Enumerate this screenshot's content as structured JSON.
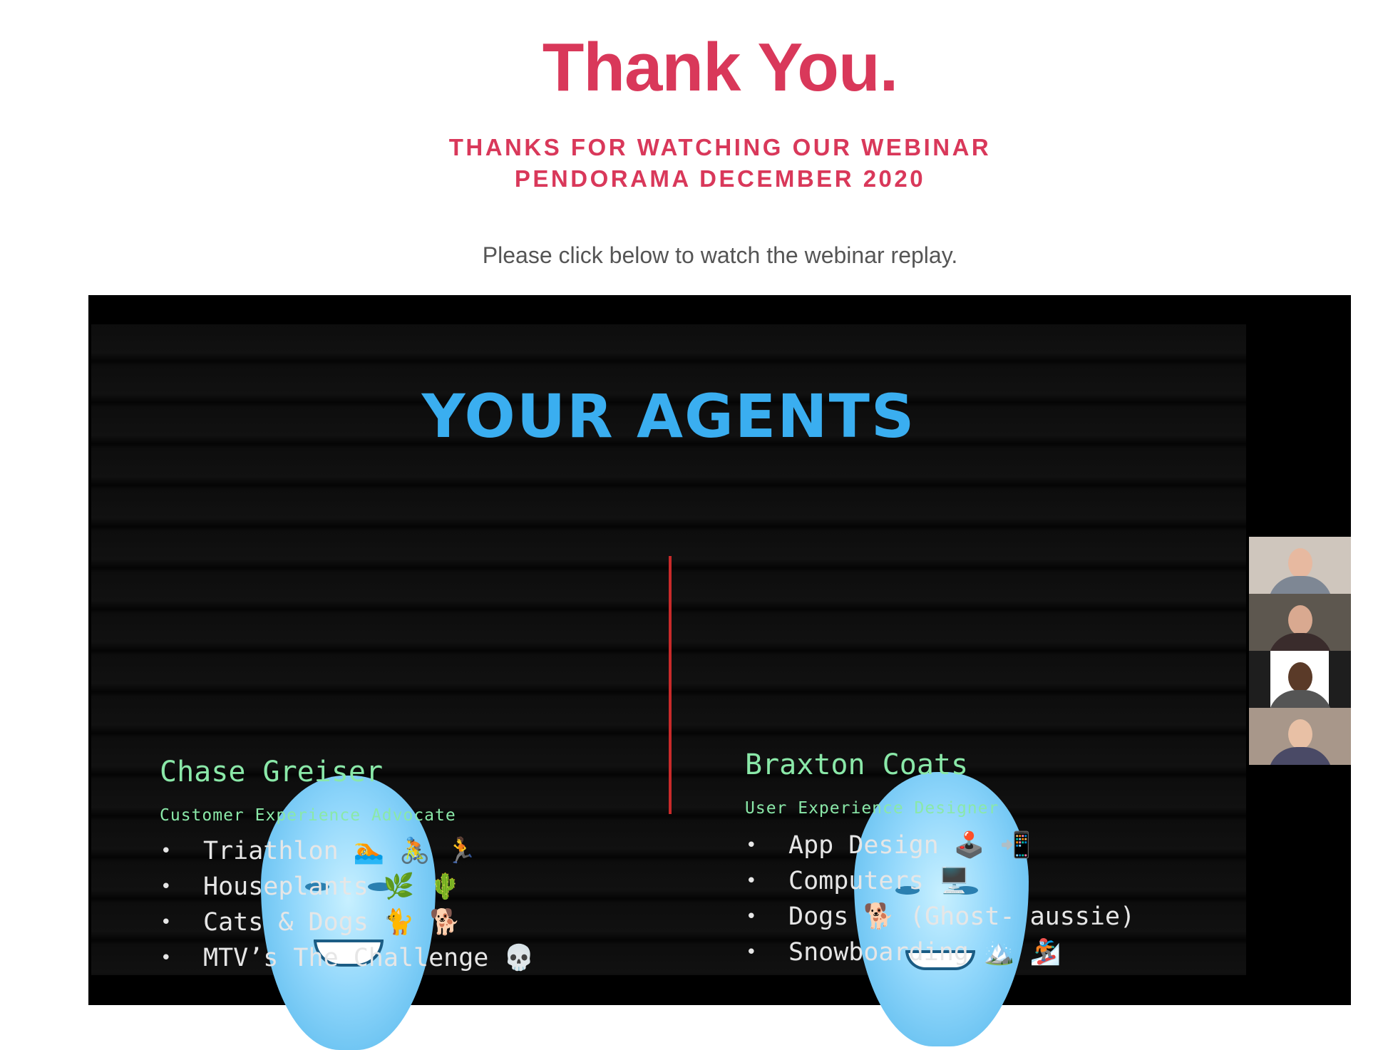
{
  "header": {
    "title": "Thank You.",
    "subtitle_line1": "THANKS FOR WATCHING OUR WEBINAR",
    "subtitle_line2": "PENDORAMA DECEMBER 2020",
    "cta": "Please click below to watch the webinar replay."
  },
  "colors": {
    "accent": "#d9385a",
    "slide_title": "#3aaef0",
    "agent_text": "#8ae8a8",
    "divider": "#c92a2a"
  },
  "video": {
    "slide_title": "YOUR AGENTS",
    "agents": [
      {
        "name": "Chase Greiser",
        "role": "Customer Experience Advocate",
        "hobbies": [
          "Triathlon 🏊 🚴 🏃",
          "Houseplants 🌿 🌵",
          "Cats & Dogs 🐈 🐕",
          "MTV’s The Challenge 💀"
        ]
      },
      {
        "name": "Braxton Coats",
        "role": "User Experience Designer",
        "hobbies": [
          "App Design 🕹️ 📲",
          "Computers 🖥️",
          "Dogs 🐕 (Ghost- aussie)",
          "Snowboarding 🏔️ 🏂"
        ]
      }
    ],
    "participants_count": 4
  }
}
